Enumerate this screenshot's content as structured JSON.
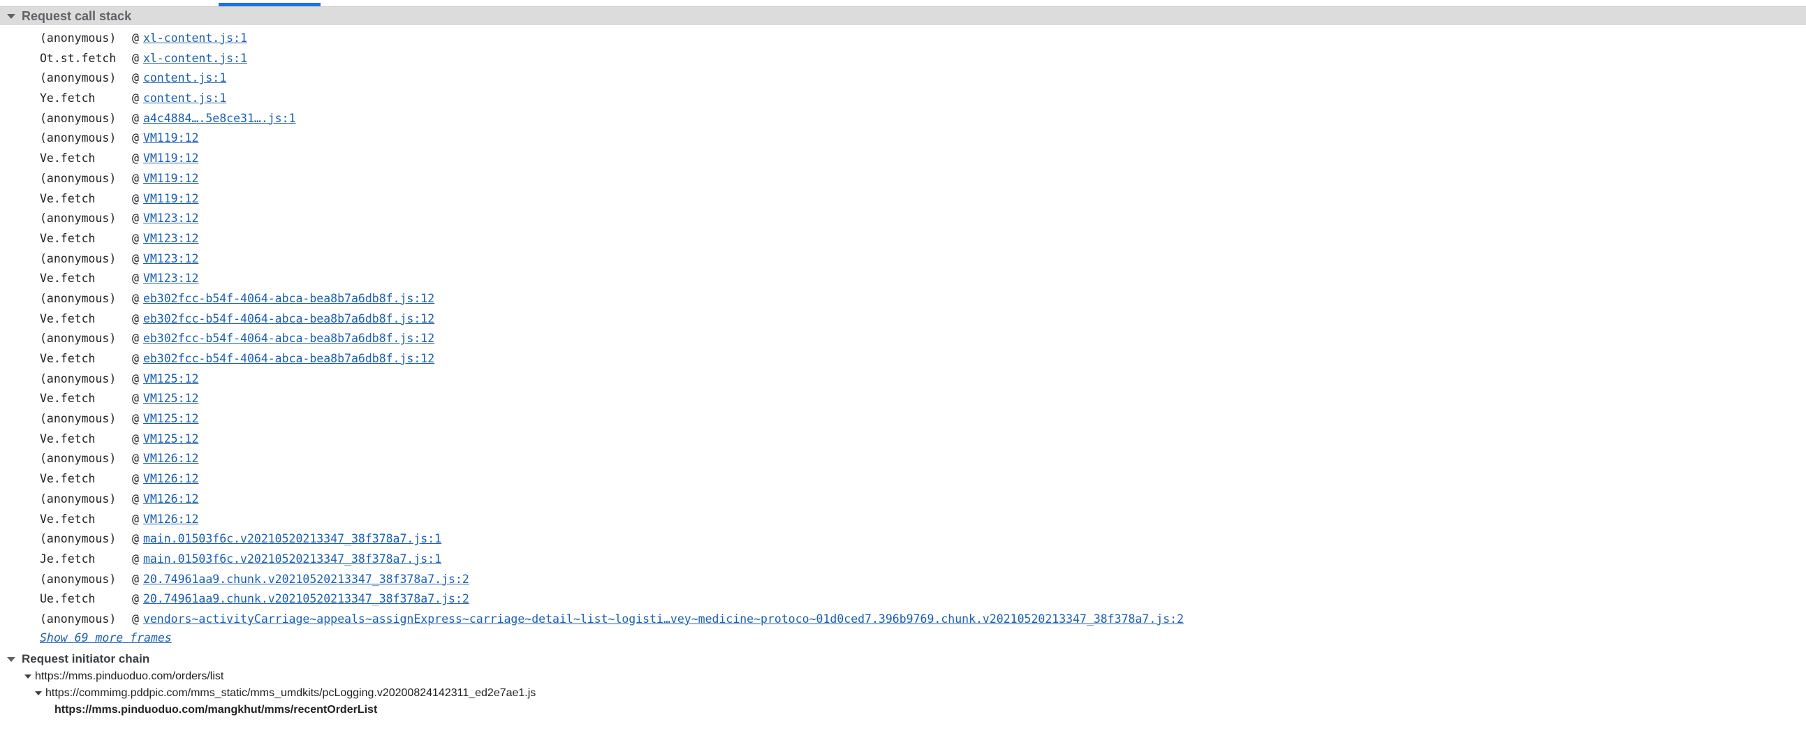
{
  "panel": {
    "active_tab_indicator": "initiator-tab-underline",
    "accent_color": "#1a73e8"
  },
  "call_stack": {
    "title": "Request call stack",
    "at_symbol": "@",
    "show_more_label": "Show 69 more frames",
    "frames": [
      {
        "fn": "(anonymous)",
        "src": "xl-content.js:1"
      },
      {
        "fn": "Ot.st.fetch",
        "src": "xl-content.js:1"
      },
      {
        "fn": "(anonymous)",
        "src": "content.js:1"
      },
      {
        "fn": "Ye.fetch",
        "src": "content.js:1"
      },
      {
        "fn": "(anonymous)",
        "src": "a4c4884….5e8ce31….js:1"
      },
      {
        "fn": "(anonymous)",
        "src": "VM119:12"
      },
      {
        "fn": "Ve.fetch",
        "src": "VM119:12"
      },
      {
        "fn": "(anonymous)",
        "src": "VM119:12"
      },
      {
        "fn": "Ve.fetch",
        "src": "VM119:12"
      },
      {
        "fn": "(anonymous)",
        "src": "VM123:12"
      },
      {
        "fn": "Ve.fetch",
        "src": "VM123:12"
      },
      {
        "fn": "(anonymous)",
        "src": "VM123:12"
      },
      {
        "fn": "Ve.fetch",
        "src": "VM123:12"
      },
      {
        "fn": "(anonymous)",
        "src": "eb302fcc-b54f-4064-abca-bea8b7a6db8f.js:12"
      },
      {
        "fn": "Ve.fetch",
        "src": "eb302fcc-b54f-4064-abca-bea8b7a6db8f.js:12"
      },
      {
        "fn": "(anonymous)",
        "src": "eb302fcc-b54f-4064-abca-bea8b7a6db8f.js:12"
      },
      {
        "fn": "Ve.fetch",
        "src": "eb302fcc-b54f-4064-abca-bea8b7a6db8f.js:12"
      },
      {
        "fn": "(anonymous)",
        "src": "VM125:12"
      },
      {
        "fn": "Ve.fetch",
        "src": "VM125:12"
      },
      {
        "fn": "(anonymous)",
        "src": "VM125:12"
      },
      {
        "fn": "Ve.fetch",
        "src": "VM125:12"
      },
      {
        "fn": "(anonymous)",
        "src": "VM126:12"
      },
      {
        "fn": "Ve.fetch",
        "src": "VM126:12"
      },
      {
        "fn": "(anonymous)",
        "src": "VM126:12"
      },
      {
        "fn": "Ve.fetch",
        "src": "VM126:12"
      },
      {
        "fn": "(anonymous)",
        "src": "main.01503f6c.v20210520213347_38f378a7.js:1"
      },
      {
        "fn": "Je.fetch",
        "src": "main.01503f6c.v20210520213347_38f378a7.js:1"
      },
      {
        "fn": "(anonymous)",
        "src": "20.74961aa9.chunk.v20210520213347_38f378a7.js:2"
      },
      {
        "fn": "Ue.fetch",
        "src": "20.74961aa9.chunk.v20210520213347_38f378a7.js:2"
      },
      {
        "fn": "(anonymous)",
        "src": "vendors~activityCarriage~appeals~assignExpress~carriage~detail~list~logisti…vey~medicine~protoco~01d0ced7.396b9769.chunk.v20210520213347_38f378a7.js:2"
      }
    ]
  },
  "initiator_chain": {
    "title": "Request initiator chain",
    "nodes": [
      {
        "url": "https://mms.pinduoduo.com/orders/list",
        "level": 1,
        "expandable": true,
        "current": false
      },
      {
        "url": "https://commimg.pddpic.com/mms_static/mms_umdkits/pcLogging.v20200824142311_ed2e7ae1.js",
        "level": 2,
        "expandable": true,
        "current": false
      },
      {
        "url": "https://mms.pinduoduo.com/mangkhut/mms/recentOrderList",
        "level": 3,
        "expandable": false,
        "current": true
      }
    ]
  }
}
